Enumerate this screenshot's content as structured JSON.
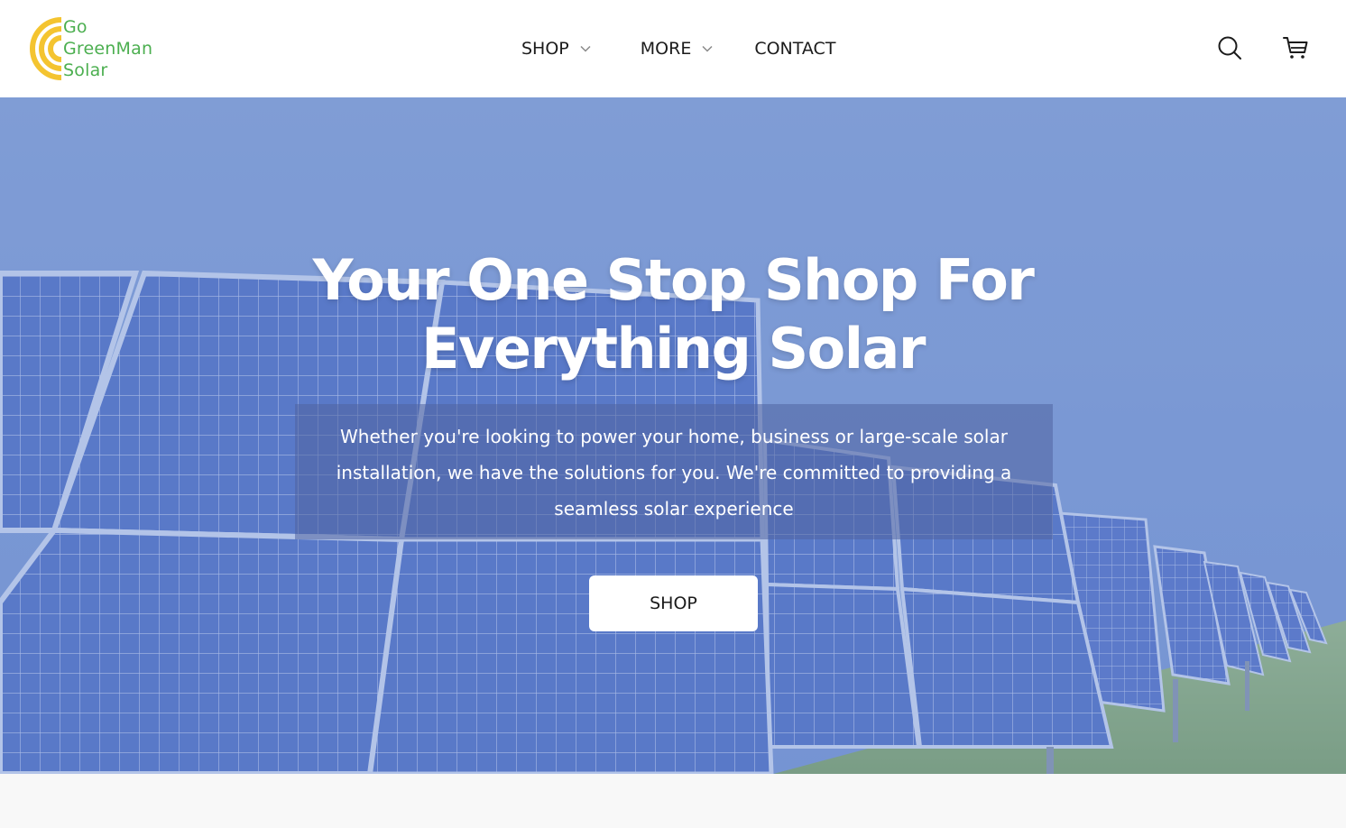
{
  "brand": {
    "logo_lines": [
      "Go",
      "GreenMan",
      "Solar"
    ],
    "logo_text_color": "#4caf50",
    "logo_mark_color": "#f4c430"
  },
  "nav": {
    "items": [
      {
        "label": "SHOP",
        "has_dropdown": true
      },
      {
        "label": "MORE",
        "has_dropdown": true
      },
      {
        "label": "CONTACT",
        "has_dropdown": false
      }
    ]
  },
  "header_icons": {
    "search": "search-icon",
    "cart": "cart-icon"
  },
  "hero": {
    "title": "Your One Stop Shop For Everything Solar",
    "description": "Whether you're looking to power your home, business or large-scale solar installation, we have the solutions for you. We're committed to providing a seamless solar experience",
    "button_label": "SHOP"
  },
  "colors": {
    "header_bg": "#ffffff",
    "hero_tint": "#7f9ed3",
    "button_bg": "#ffffff",
    "text_dark": "#1b1b1b"
  }
}
